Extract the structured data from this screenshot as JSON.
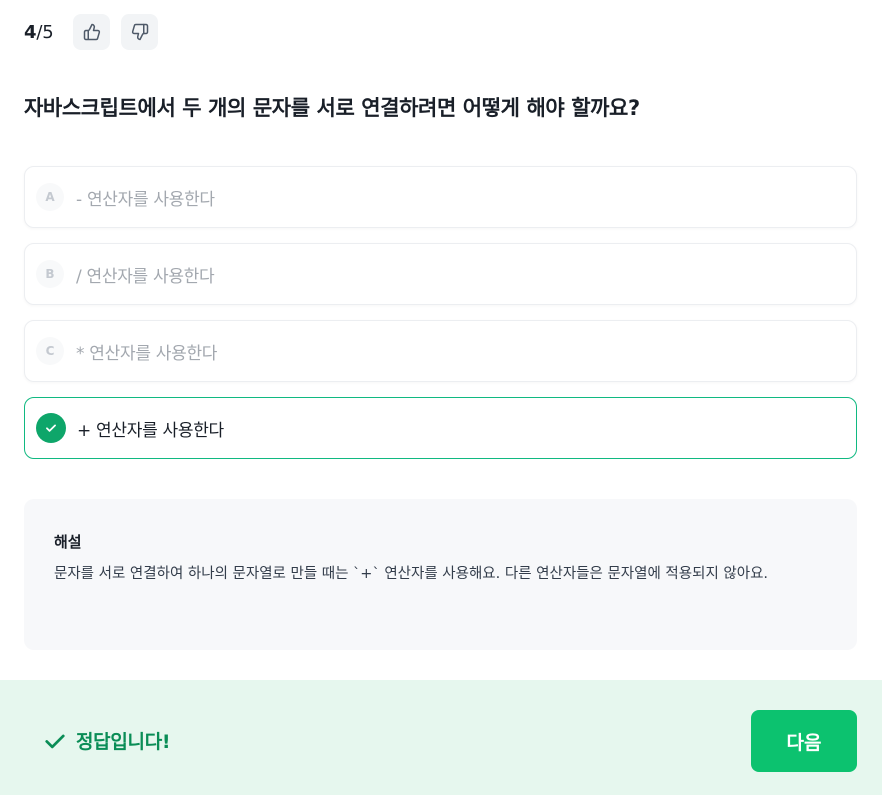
{
  "header": {
    "current": "4",
    "total": "/5",
    "like_icon": "thumbs-up-icon",
    "dislike_icon": "thumbs-down-icon"
  },
  "question": "자바스크립트에서 두 개의 문자를 서로 연결하려면 어떻게 해야 할까요?",
  "options": [
    {
      "letter": "A",
      "text": "- 연산자를 사용한다"
    },
    {
      "letter": "B",
      "text": "/ 연산자를 사용한다"
    },
    {
      "letter": "C",
      "text": "* 연산자를 사용한다"
    },
    {
      "letter": "",
      "text": "+ 연산자를 사용한다",
      "icon": "check-icon",
      "selected": true
    }
  ],
  "explanation": {
    "title": "해설",
    "body": "문자를 서로 연결하여 하나의 문자열로 만들 때는 `+` 연산자를 사용해요. 다른 연산자들은 문자열에 적용되지 않아요."
  },
  "footer": {
    "result_text": "정답입니다!",
    "next_label": "다음"
  },
  "colors": {
    "accent": "#0cc26f",
    "correct_border": "#10b981",
    "footer_bg": "#e6f7ee",
    "result_text": "#0a8d56"
  }
}
